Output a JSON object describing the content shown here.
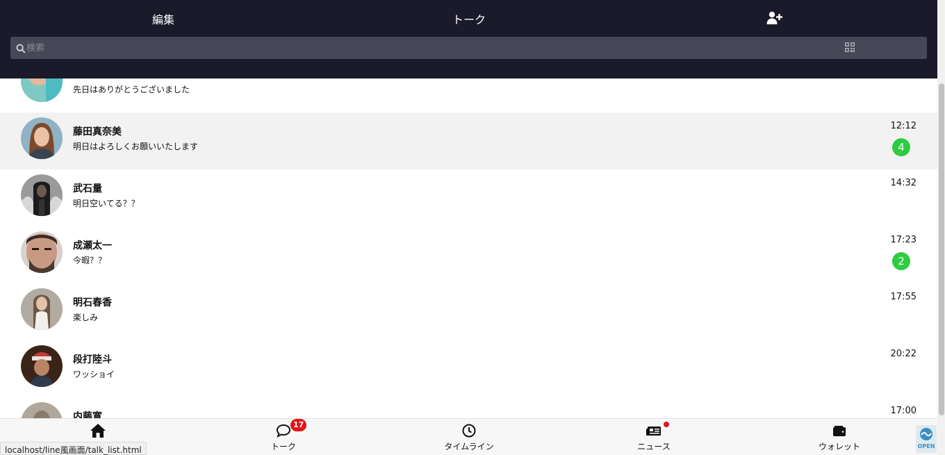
{
  "header": {
    "edit_label": "編集",
    "title": "トーク",
    "add_friend_icon": "user-plus-icon"
  },
  "search": {
    "placeholder": "検索",
    "value": "",
    "search_icon": "search-icon",
    "qr_icon": "qr-code-icon"
  },
  "chats": [
    {
      "name": "",
      "message": "先日はありがとうございました",
      "time": "",
      "unread": ""
    },
    {
      "name": "藤田真奈美",
      "message": "明日はよろしくお願いいたします",
      "time": "12:12",
      "unread": "4"
    },
    {
      "name": "武石量",
      "message": "明日空いてる？？",
      "time": "14:32",
      "unread": ""
    },
    {
      "name": "成瀬太一",
      "message": "今暇？？",
      "time": "17:23",
      "unread": "2"
    },
    {
      "name": "明石春香",
      "message": "楽しみ",
      "time": "17:55",
      "unread": ""
    },
    {
      "name": "段打陸斗",
      "message": "ワッショイ",
      "time": "20:22",
      "unread": ""
    },
    {
      "name": "内藤寛",
      "message": "",
      "time": "17:00",
      "unread": ""
    }
  ],
  "bottom_nav": [
    {
      "label": "",
      "icon": "home-icon"
    },
    {
      "label": "トーク",
      "icon": "chat-bubble-icon",
      "badge": "17"
    },
    {
      "label": "タイムライン",
      "icon": "clock-icon"
    },
    {
      "label": "ニュース",
      "icon": "newspaper-icon"
    },
    {
      "label": "ウォレット",
      "icon": "wallet-icon"
    }
  ],
  "browser_status": "localhost/line風画面/talk_list.html",
  "open_widget_label": "OPEN",
  "colors": {
    "header_bg": "#1a1a2b",
    "search_bg": "#474757",
    "selected_row_bg": "#f2f2f2",
    "unread_badge": "#2ecc40",
    "notification_red": "#e3141b"
  }
}
